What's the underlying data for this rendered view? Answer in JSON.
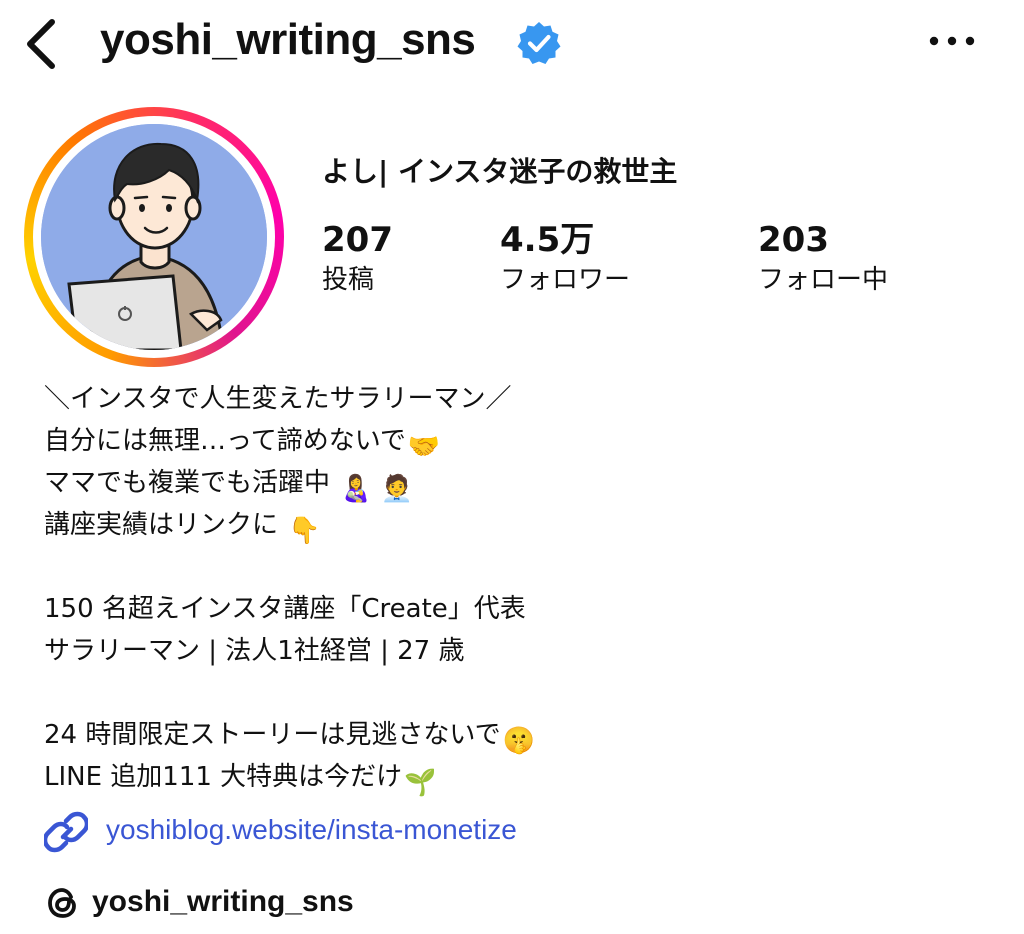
{
  "header": {
    "username": "yoshi_writing_sns",
    "verified": true,
    "back_icon": "chevron-left-icon",
    "more_icon": "more-horizontal-icon",
    "verified_color": "#3897f0"
  },
  "profile": {
    "display_name": "よし| インスタ迷子の救世主",
    "avatar_ring_colors": [
      "#ff00aa",
      "#ff2a68",
      "#ff9a00",
      "#ffd200"
    ],
    "avatar_bg": "#8fabe8",
    "stats": [
      {
        "count": "207",
        "label": "投稿"
      },
      {
        "count": "4.5万",
        "label": "フォロワー"
      },
      {
        "count": "203",
        "label": "フォロー中"
      }
    ]
  },
  "bio": {
    "line1": "＼インスタで人生変えたサラリーマン／",
    "line2": "自分には無理…って諦めないで",
    "line2_emoji": "🤝",
    "line3": "ママでも複業でも活躍中",
    "line3_emoji": "👩‍🍼 🧑‍💼",
    "line4": "講座実績はリンクに",
    "line4_emoji": "👇",
    "line5": "150 名超えインスタ講座「Create」代表",
    "line6": "サラリーマン | 法人1社経営 | 27 歳",
    "line7": "24 時間限定ストーリーは見逃さないで",
    "line7_emoji": "🤫",
    "line8": "LINE 追加111 大特典は今だけ",
    "line8_emoji": "🌱"
  },
  "link": {
    "text": "yoshiblog.website/insta-monetize",
    "icon": "link-icon",
    "color": "#3a56d4"
  },
  "threads": {
    "handle": "yoshi_writing_sns",
    "icon": "threads-icon"
  }
}
